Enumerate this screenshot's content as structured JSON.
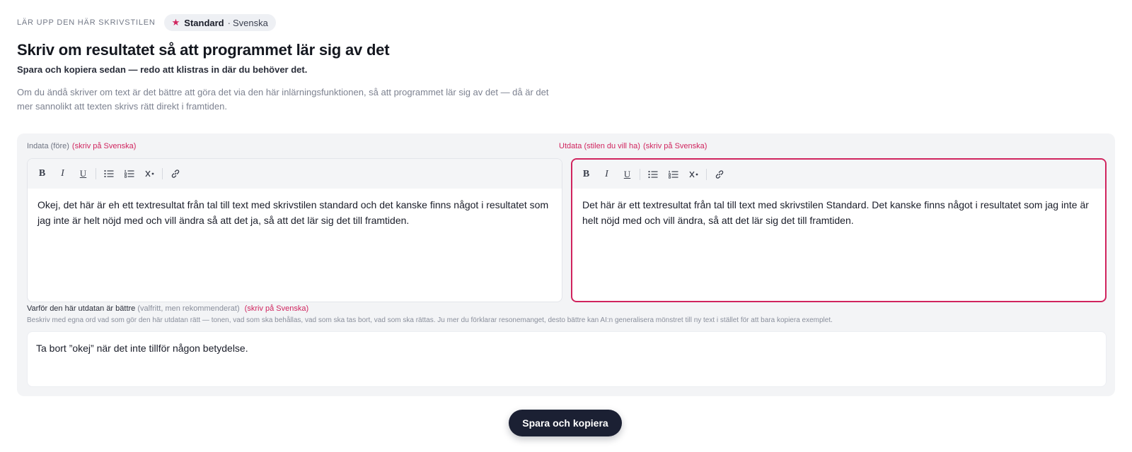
{
  "header": {
    "kicker": "LÄR UPP DEN HÄR SKRIVSTILEN",
    "pill": {
      "star_icon": "★",
      "name": "Standard",
      "separator": "·",
      "language": "Svenska"
    },
    "title": "Skriv om resultatet så att programmet lär sig av det",
    "subtitle": "Spara och kopiera sedan — redo att klistras in där du behöver det.",
    "description": "Om du ändå skriver om text är det bättre att göra det via den här inlärningsfunktionen, så att programmet lär sig av det — då är det mer sannolikt att texten skrivs rätt direkt i framtiden."
  },
  "input_editor": {
    "label": "Indata (före)",
    "hint": "(skriv på Svenska)",
    "text": "Okej, det här är eh ett textresultat från tal till text med skrivstilen standard och det kanske finns något i resultatet som jag inte är helt nöjd med och vill ändra så att det ja, så att det lär sig det till framtiden."
  },
  "output_editor": {
    "label": "Utdata (stilen du vill ha)",
    "hint": "(skriv på Svenska)",
    "text": "Det här är ett textresultat från tal till text med skrivstilen Standard. Det kanske finns något i resultatet som jag inte är helt nöjd med och vill ändra, så att det lär sig det till framtiden."
  },
  "toolbar": {
    "bold": "B",
    "italic": "I",
    "underline": "U",
    "bullet_list_icon": "bullet-list",
    "numbered_list_icon": "numbered-list",
    "clear_format_icon": "clear-format",
    "link_icon": "link"
  },
  "reason": {
    "label": "Varför den här utdatan är bättre",
    "optional": "(valfritt, men rekommenderat)",
    "hint": "(skriv på Svenska)",
    "help": "Beskriv med egna ord vad som gör den här utdatan rätt — tonen, vad som ska behållas, vad som ska tas bort, vad som ska rättas. Ju mer du förklarar resonemanget, desto bättre kan AI:n generalisera mönstret till ny text i stället för att bara kopiera exemplet.",
    "text": "Ta bort ”okej” när det inte tillför någon betydelse."
  },
  "actions": {
    "save_label": "Spara och kopiera"
  },
  "colors": {
    "accent": "#d0245e",
    "button": "#1b2033",
    "panel": "#f3f4f6"
  }
}
